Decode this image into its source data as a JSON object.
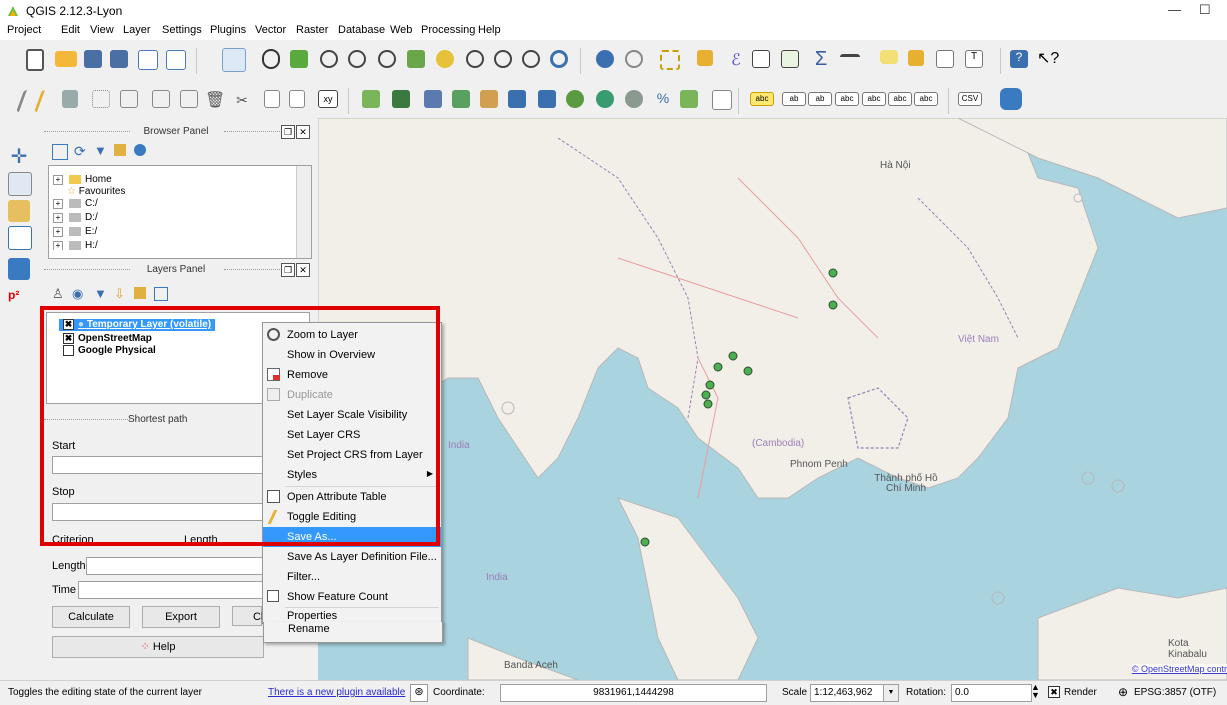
{
  "window": {
    "title": "QGIS 2.12.3-Lyon",
    "minimize": "—",
    "maximize": "☐"
  },
  "menu": [
    "Project",
    "Edit",
    "View",
    "Layer",
    "Settings",
    "Plugins",
    "Vector",
    "Raster",
    "Database",
    "Web",
    "Processing",
    "Help"
  ],
  "browser_panel": {
    "title": "Browser Panel",
    "items": [
      "Home",
      "Favourites",
      "C:/",
      "D:/",
      "E:/",
      "H:/"
    ]
  },
  "layers_panel": {
    "title": "Layers Panel",
    "layers": [
      {
        "name": "Temporary Layer (volatile)",
        "checked": true,
        "selected": true
      },
      {
        "name": "OpenStreetMap",
        "checked": true,
        "selected": false
      },
      {
        "name": "Google Physical",
        "checked": false,
        "selected": false
      }
    ]
  },
  "shortest_path": {
    "title": "Shortest path",
    "start_label": "Start",
    "stop_label": "Stop",
    "criterion_label": "Criterion",
    "criterion_value": "Length",
    "length_label": "Length",
    "time_label": "Time",
    "calculate": "Calculate",
    "export": "Export",
    "clear": "Cl",
    "help": "Help"
  },
  "context_menu": {
    "items": [
      {
        "label": "Zoom to Layer",
        "icon": "zoom-icon",
        "enabled": true
      },
      {
        "label": "Show in Overview",
        "icon": "",
        "enabled": true
      },
      {
        "label": "Remove",
        "icon": "remove-icon",
        "enabled": true
      },
      {
        "label": "Duplicate",
        "icon": "duplicate-icon",
        "enabled": false
      },
      {
        "label": "Set Layer Scale Visibility",
        "icon": "",
        "enabled": true
      },
      {
        "label": "Set Layer CRS",
        "icon": "",
        "enabled": true
      },
      {
        "label": "Set Project CRS from Layer",
        "icon": "",
        "enabled": true
      },
      {
        "label": "Styles",
        "icon": "",
        "enabled": true,
        "submenu": true
      },
      {
        "label": "Open Attribute Table",
        "icon": "table-icon",
        "enabled": true
      },
      {
        "label": "Toggle Editing",
        "icon": "pencil-icon",
        "enabled": true
      },
      {
        "label": "Save As...",
        "icon": "",
        "enabled": true,
        "highlighted": true
      },
      {
        "label": "Save As Layer Definition File...",
        "icon": "",
        "enabled": true
      },
      {
        "label": "Filter...",
        "icon": "",
        "enabled": true
      },
      {
        "label": "Show Feature Count",
        "icon": "checkbox-icon",
        "enabled": true
      },
      {
        "label": "Properties",
        "icon": "",
        "enabled": true
      },
      {
        "label": "Rename",
        "icon": "",
        "enabled": true
      }
    ]
  },
  "map_labels": {
    "india": "India",
    "cambodia": "(Cambodia)",
    "phnom_penh": "Phnom Penh",
    "viet_nam": "Việt Nam",
    "thanh_pho_ho_chi_minh": "Thành phố Hồ Chí Minh",
    "kota_kinabalu": "Kota Kinabalu",
    "banda_aceh": "Banda Aceh",
    "ha_noi": "Hà Nội",
    "osm_credit": "© OpenStreetMap contr"
  },
  "status": {
    "message": "Toggles the editing state of the current layer",
    "plugin_link": "There is a new plugin available",
    "coordinate_label": "Coordinate:",
    "coordinate_value": "9831961,1444298",
    "scale_label": "Scale",
    "scale_value": "1:12,463,962",
    "rotation_label": "Rotation:",
    "rotation_value": "0.0",
    "render_label": "Render",
    "crs": "EPSG:3857 (OTF)"
  },
  "colors": {
    "accent": "#3399ff",
    "highlight_box": "#e00000",
    "map_water": "#a9d3df",
    "map_land": "#f2efe9"
  }
}
